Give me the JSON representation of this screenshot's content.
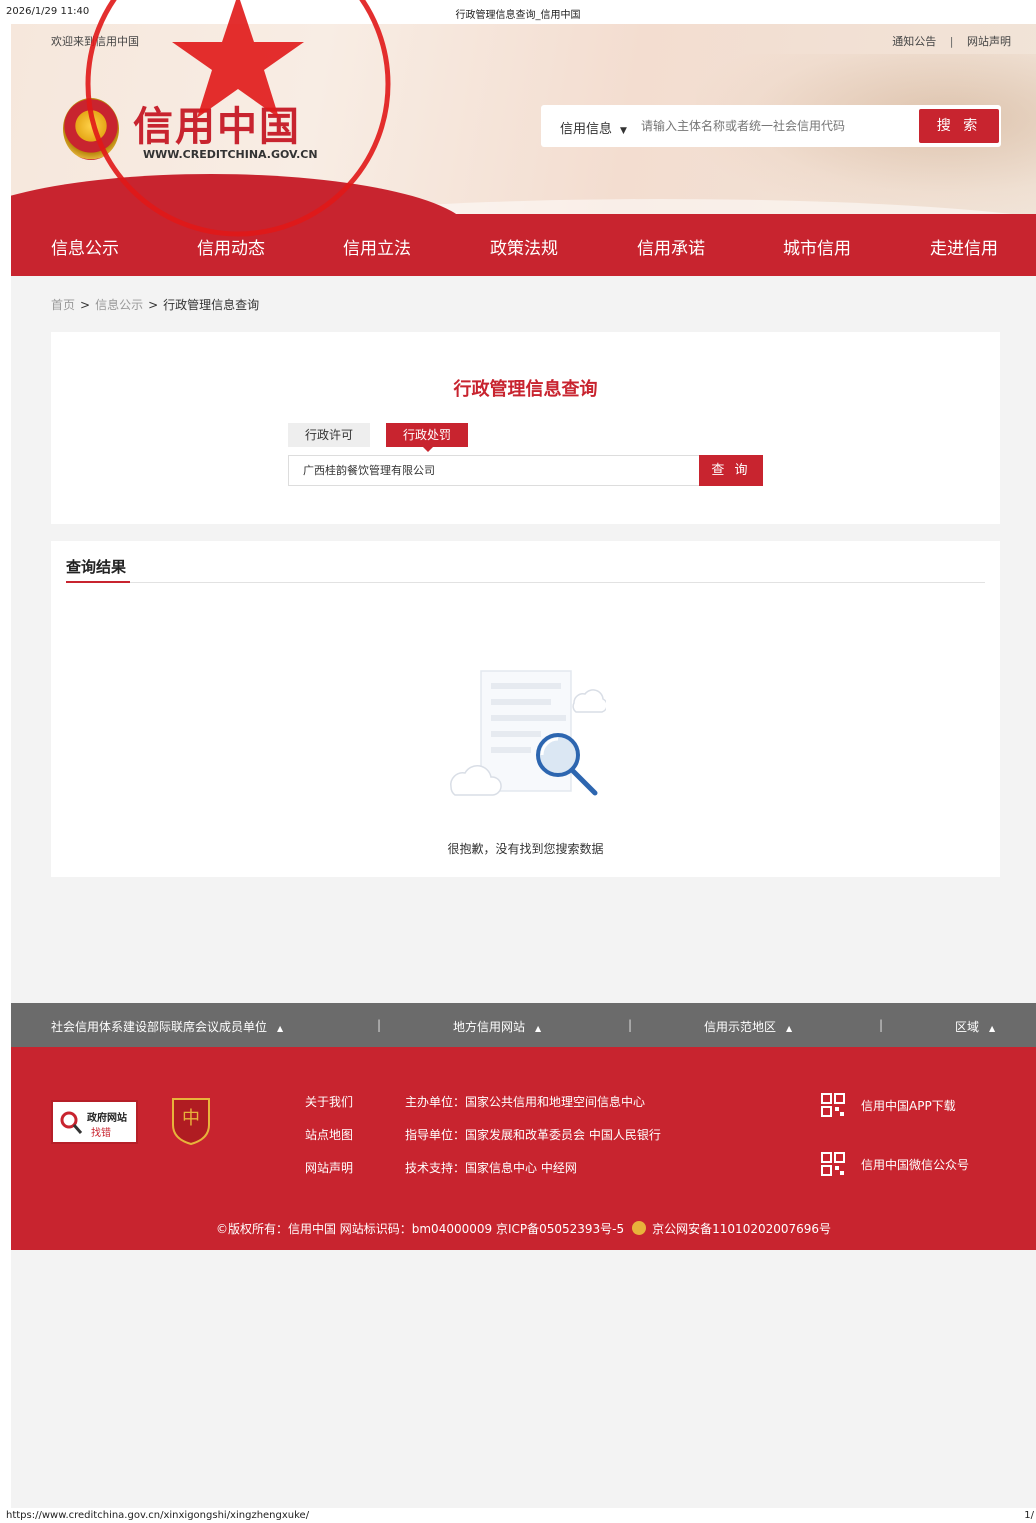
{
  "print": {
    "datetime": "2026/1/29 11:40",
    "page_title": "行政管理信息查询_信用中国",
    "url": "https://www.creditchina.gov.cn/xinxigongshi/xingzhengxuke/",
    "page_no": "1/"
  },
  "topbar": {
    "welcome": "欢迎来到信用中国",
    "notice": "通知公告",
    "separator": "|",
    "statement": "网站声明"
  },
  "logo": {
    "title": "信用中国",
    "url": "WWW.CREDITCHINA.GOV.CN"
  },
  "search": {
    "category": "信用信息",
    "placeholder": "请输入主体名称或者统一社会信用代码",
    "button": "搜 索"
  },
  "nav": {
    "items": [
      "信息公示",
      "信用动态",
      "信用立法",
      "政策法规",
      "信用承诺",
      "城市信用",
      "走进信用"
    ]
  },
  "breadcrumb": {
    "home": "首页",
    "section": "信息公示",
    "current": "行政管理信息查询",
    "gt": ">"
  },
  "query": {
    "title": "行政管理信息查询",
    "tab_permit": "行政许可",
    "tab_penalty": "行政处罚",
    "active_tab": "行政处罚",
    "input_value": "广西桂韵餐饮管理有限公司",
    "button": "查 询"
  },
  "results": {
    "heading": "查询结果",
    "empty_message": "很抱歉，没有找到您搜索数据"
  },
  "links_bar": {
    "groups": [
      "社会信用体系建设部际联席会议成员单位",
      "地方信用网站",
      "信用示范地区",
      "区域"
    ],
    "separator": "|"
  },
  "footer": {
    "badge_gov_title": "政府网站",
    "badge_gov_sub": "找错",
    "col1": [
      "关于我们",
      "站点地图",
      "网站声明"
    ],
    "col2": [
      "主办单位：国家公共信用和地理空间信息中心",
      "指导单位：国家发展和改革委员会 中国人民银行",
      "技术支持：国家信息中心 中经网"
    ],
    "app_download": "信用中国APP下载",
    "wechat": "信用中国微信公众号",
    "copyright": "©版权所有：信用中国   网站标识码：bm04000009   京ICP备05052393号-5",
    "police_record": "京公网安备11010202007696号"
  },
  "seal": {
    "text": "广西桂韵餐饮管理有限公司"
  },
  "colors": {
    "brand_red": "#c8242f",
    "links_bar_gray": "#6b6b6b",
    "page_bg": "#f3f3f3",
    "seal_red": "#e01818"
  }
}
